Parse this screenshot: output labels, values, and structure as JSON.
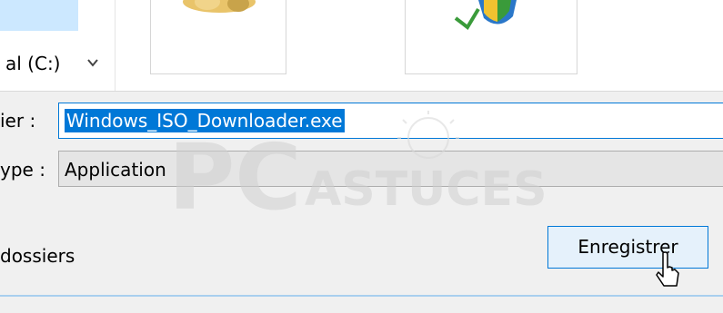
{
  "navigation": {
    "drive_label": "al (C:)"
  },
  "fields": {
    "name_label": "ier :",
    "name_value": "Windows_ISO_Downloader.exe",
    "type_label": "ype :",
    "type_value": "Application"
  },
  "footer": {
    "hide_folders_label": "dossiers",
    "save_label": "Enregistrer"
  },
  "watermark": {
    "brand_big": "PC",
    "brand_small": "ASTUCES"
  },
  "colors": {
    "accent": "#0078d7",
    "panel_bg": "#f0f0f0",
    "selection_bg": "#0078d7",
    "button_bg": "#e5f1fb"
  }
}
